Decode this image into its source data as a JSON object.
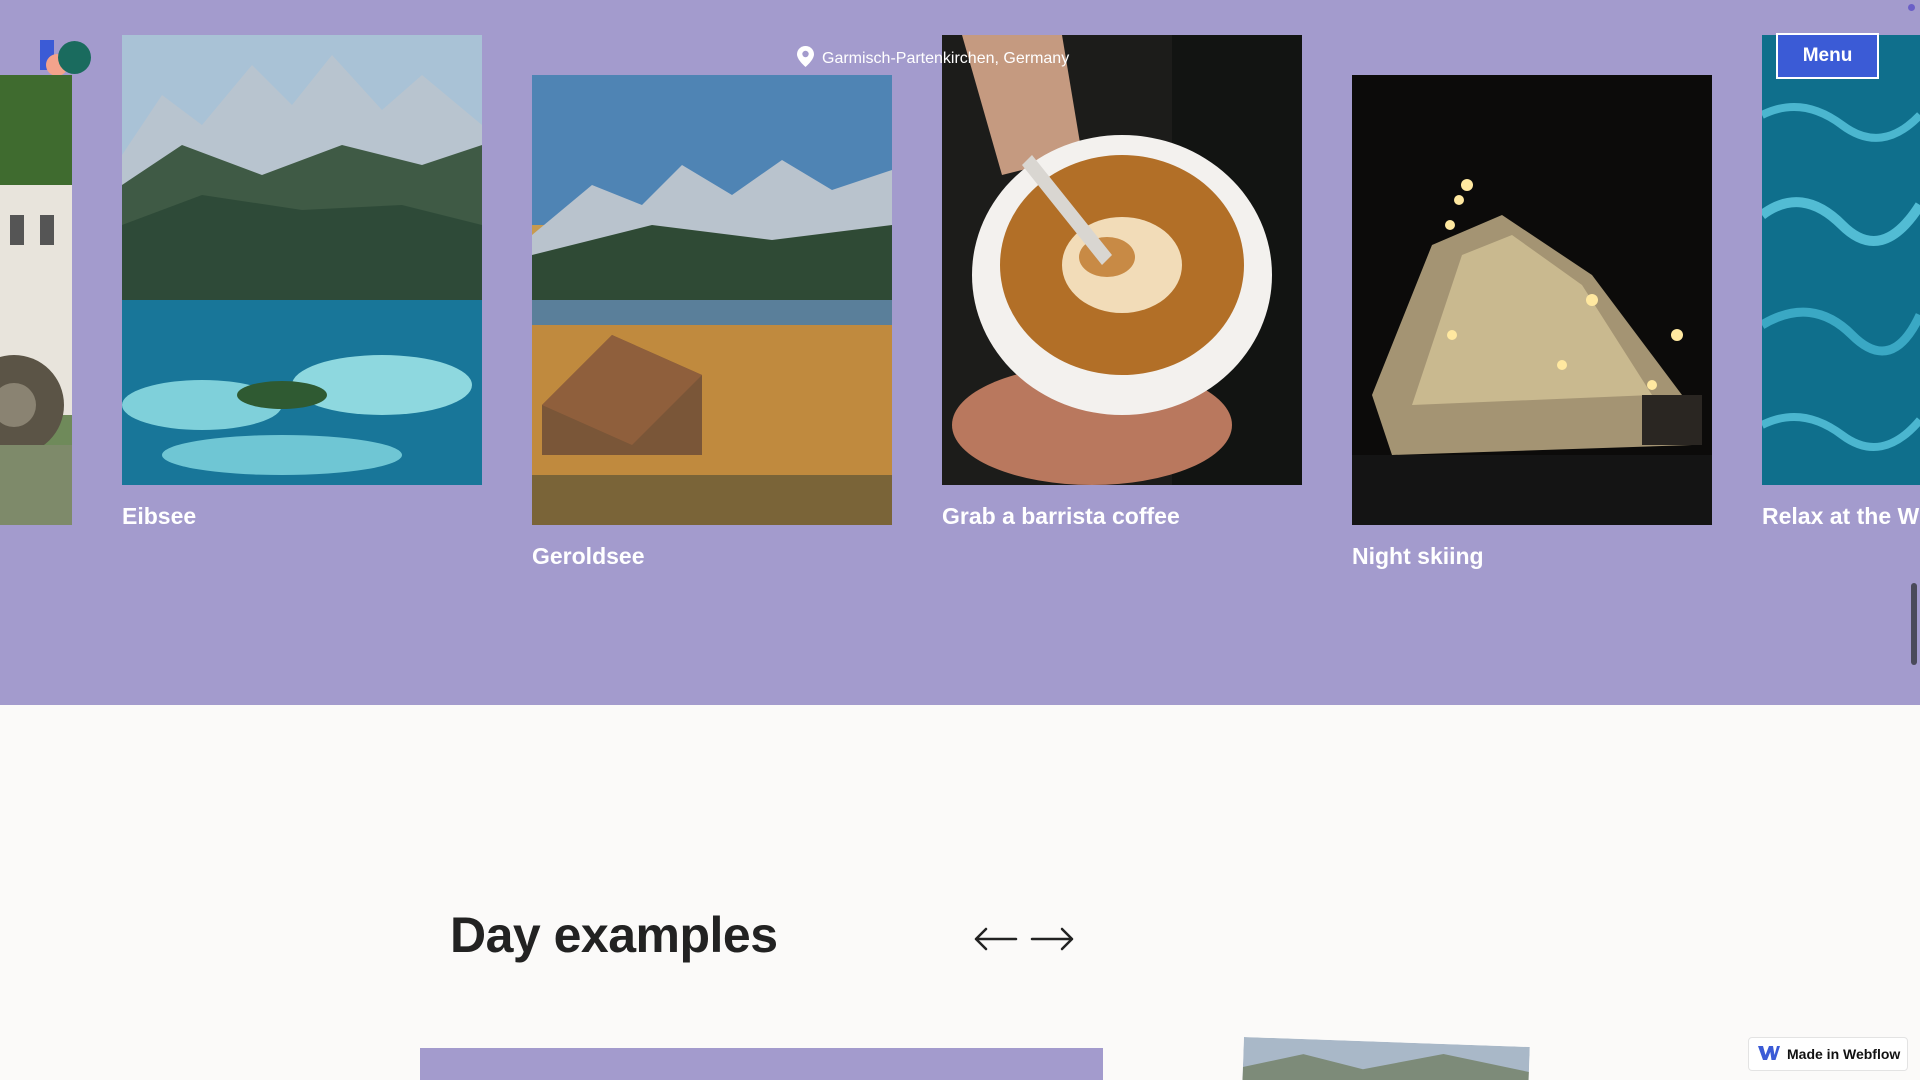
{
  "header": {
    "location": "Garmisch-Partenkirchen, Germany",
    "menu_label": "Menu"
  },
  "carousel": {
    "cards": [
      {
        "title": ""
      },
      {
        "title": "Eibsee"
      },
      {
        "title": "Geroldsee"
      },
      {
        "title": "Grab a barrista coffee"
      },
      {
        "title": "Night skiing"
      },
      {
        "title": "Relax at the W"
      }
    ]
  },
  "day_examples": {
    "heading": "Day examples"
  },
  "badge": {
    "label": "Made in Webflow"
  },
  "colors": {
    "hero_bg": "#a39bcd",
    "accent_blue": "#3b5bd6",
    "page_bg": "#fbfaf9"
  },
  "icons": [
    "location-pin-icon",
    "arrow-left-icon",
    "arrow-right-icon",
    "webflow-logo-icon"
  ]
}
